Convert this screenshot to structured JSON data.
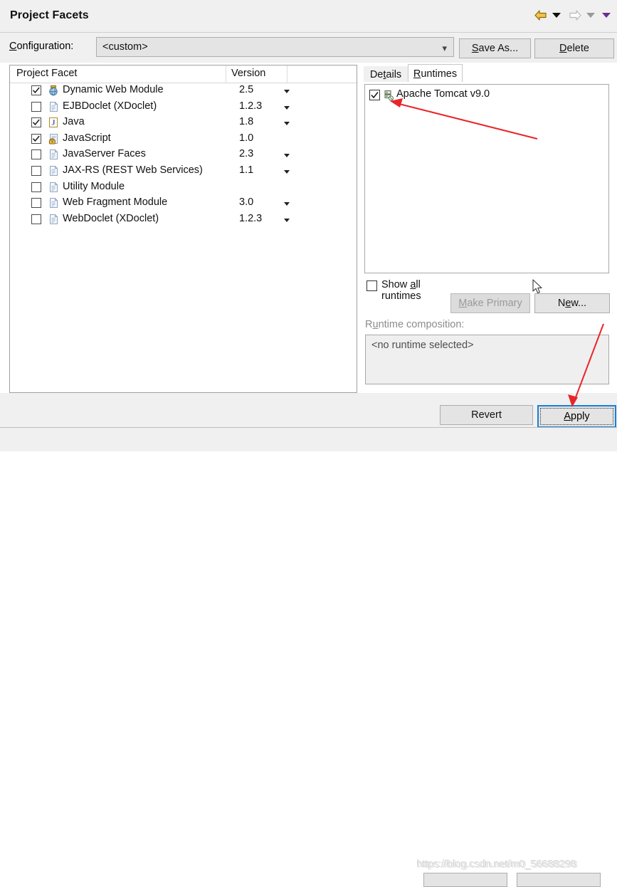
{
  "window": {
    "title": "Project Facets"
  },
  "nav": {
    "back_icon": "back-arrow-icon",
    "back_menu_icon": "chevron-down-icon",
    "forward_icon": "forward-arrow-icon",
    "forward_menu_icon": "chevron-down-icon",
    "overflow_menu_icon": "chevron-down-icon"
  },
  "configuration": {
    "label": "Configuration:",
    "value": "<custom>",
    "dropdown_icon": "chevron-down-icon",
    "save_as_label": "Save As...",
    "delete_label": "Delete"
  },
  "facet_table": {
    "columns": [
      "Project Facet",
      "Version"
    ],
    "rows": [
      {
        "name": "Dynamic Web Module",
        "version": "2.5",
        "checked": true,
        "icon": "web-module-icon",
        "has_dropdown": true
      },
      {
        "name": "EJBDoclet (XDoclet)",
        "version": "1.2.3",
        "checked": false,
        "icon": "document-icon",
        "has_dropdown": true
      },
      {
        "name": "Java",
        "version": "1.8",
        "checked": true,
        "icon": "java-icon",
        "has_dropdown": true
      },
      {
        "name": "JavaScript",
        "version": "1.0",
        "checked": true,
        "icon": "javascript-lock-icon",
        "has_dropdown": false
      },
      {
        "name": "JavaServer Faces",
        "version": "2.3",
        "checked": false,
        "icon": "document-icon",
        "has_dropdown": true
      },
      {
        "name": "JAX-RS (REST Web Services)",
        "version": "1.1",
        "checked": false,
        "icon": "document-icon",
        "has_dropdown": true
      },
      {
        "name": "Utility Module",
        "version": "",
        "checked": false,
        "icon": "document-icon",
        "has_dropdown": false
      },
      {
        "name": "Web Fragment Module",
        "version": "3.0",
        "checked": false,
        "icon": "document-icon",
        "has_dropdown": true
      },
      {
        "name": "WebDoclet (XDoclet)",
        "version": "1.2.3",
        "checked": false,
        "icon": "document-icon",
        "has_dropdown": true
      }
    ]
  },
  "tabs": [
    {
      "label": "Details",
      "active": false
    },
    {
      "label": "Runtimes",
      "active": true
    }
  ],
  "runtimes": {
    "items": [
      {
        "label": "Apache Tomcat v9.0",
        "checked": true,
        "icon": "server-runtime-icon"
      }
    ],
    "show_all_label": "Show all runtimes",
    "show_all_checked": false,
    "make_primary_label": "Make Primary",
    "make_primary_enabled": false,
    "new_label": "New...",
    "composition_label": "Runtime composition:",
    "composition_value": "<no runtime selected>"
  },
  "footer": {
    "revert_label": "Revert",
    "apply_label": "Apply",
    "watermark": "https://blog.csdn.net/m0_56688298"
  },
  "colors": {
    "accent_focus": "#1a7fd4",
    "annotation_red": "#e8252a",
    "panel_bg": "#f0f0f0",
    "control_bg": "#e4e4e4",
    "border": "#a0a0a0"
  }
}
